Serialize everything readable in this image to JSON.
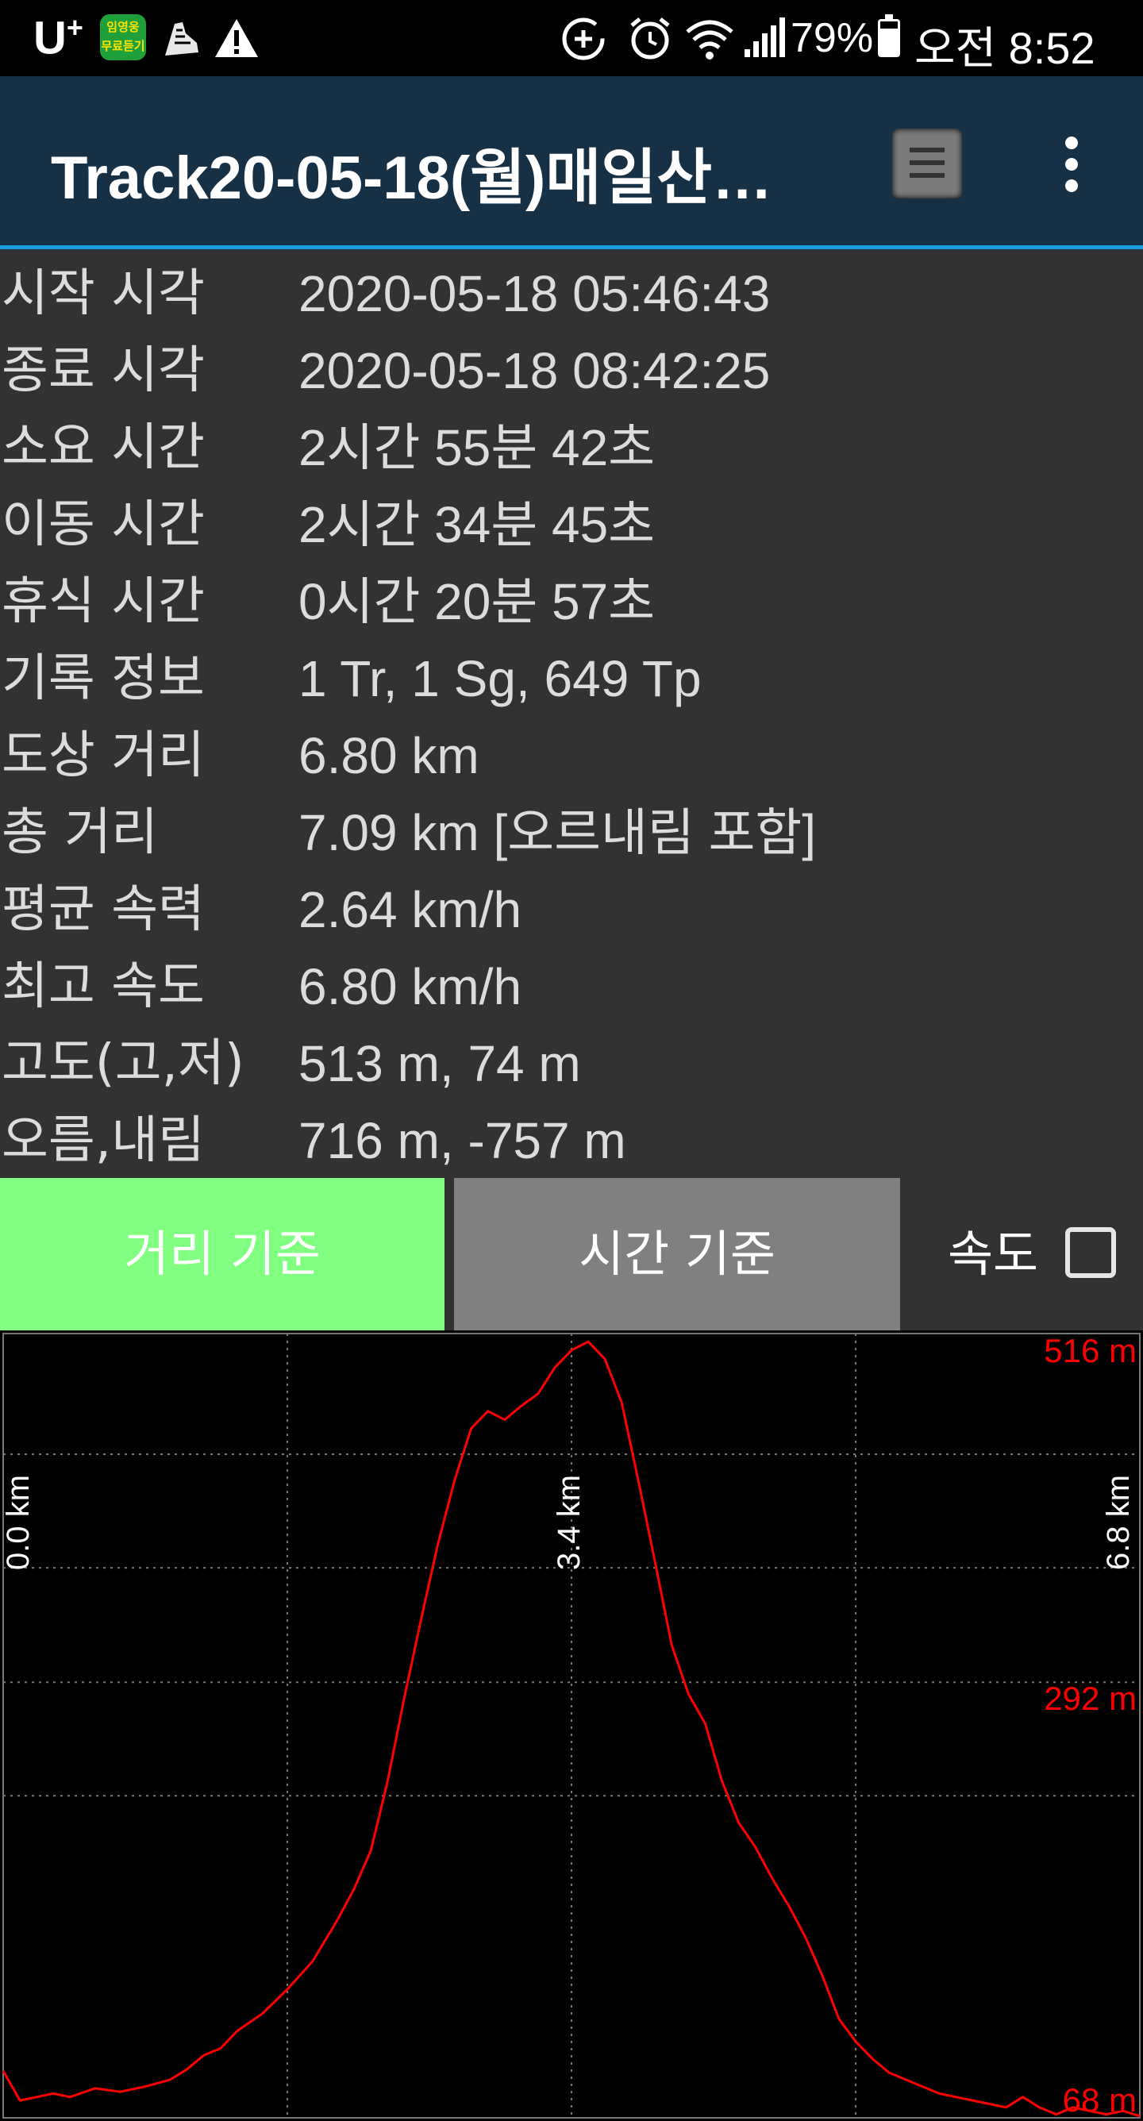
{
  "status_bar": {
    "carrier": "U",
    "carrier_sup": "+",
    "app_badge_line1": "임영웅",
    "app_badge_line2": "무료듣기",
    "icons": [
      "app-notification-icon",
      "shoe-icon",
      "warning-icon",
      "data-saver-icon",
      "alarm-icon",
      "wifi-icon",
      "signal-icon",
      "battery-icon"
    ],
    "battery_percent": "79%",
    "battery_level": 0.79,
    "time": "오전 8:52"
  },
  "appbar": {
    "title": "Track20-05-18(월)매일산…",
    "background": "#163146",
    "accent": "#1a9be0"
  },
  "stats": [
    {
      "label": "시작 시각",
      "value": "2020-05-18 05:46:43"
    },
    {
      "label": "종료 시각",
      "value": "2020-05-18 08:42:25"
    },
    {
      "label": "소요 시간",
      "value": "2시간 55분 42초"
    },
    {
      "label": "이동 시간",
      "value": "2시간 34분 45초"
    },
    {
      "label": "휴식 시간",
      "value": "0시간 20분 57초"
    },
    {
      "label": "기록 정보",
      "value": "1 Tr, 1 Sg, 649 Tp"
    },
    {
      "label": "도상 거리",
      "value": "6.80 km"
    },
    {
      "label": "총 거리",
      "value": "7.09 km [오르내림 포함]"
    },
    {
      "label": "평균 속력",
      "value": "2.64 km/h"
    },
    {
      "label": "최고 속도",
      "value": "6.80 km/h"
    },
    {
      "label": "고도(고,저)",
      "value": "513 m, 74 m"
    },
    {
      "label": "오름,내림",
      "value": "716 m, -757 m"
    }
  ],
  "buttons": {
    "distance": "거리 기준",
    "time": "시간 기준",
    "speed_label": "속도",
    "speed_checked": false,
    "distance_color": "#80ff80",
    "time_color": "#808080"
  },
  "chart_data": {
    "type": "line",
    "line_color": "#ff0000",
    "grid": true,
    "x_labels": [
      "0.0 km",
      "3.4 km",
      "6.8 km"
    ],
    "x_range": [
      0,
      6.8
    ],
    "y_labels": [
      "516 m",
      "292 m",
      "68 m"
    ],
    "y_range": [
      68,
      516
    ],
    "series": [
      {
        "x": [
          0.0,
          0.1,
          0.2,
          0.3,
          0.4,
          0.55,
          0.7,
          0.85,
          1.0,
          1.1,
          1.2,
          1.3,
          1.4,
          1.55,
          1.7,
          1.85,
          2.0,
          2.1,
          2.2,
          2.3,
          2.4,
          2.5,
          2.6,
          2.7,
          2.8,
          2.9,
          3.0,
          3.1,
          3.2,
          3.3,
          3.4,
          3.5,
          3.6,
          3.7,
          3.8,
          3.9,
          4.0,
          4.1,
          4.2,
          4.3,
          4.4,
          4.5,
          4.6,
          4.7,
          4.8,
          4.9,
          5.0,
          5.1,
          5.2,
          5.3,
          5.4,
          5.5,
          5.6,
          5.7,
          5.8,
          5.9,
          6.0,
          6.1,
          6.2,
          6.3,
          6.4,
          6.5,
          6.6,
          6.7,
          6.8
        ],
        "y": [
          95,
          78,
          80,
          82,
          80,
          85,
          83,
          86,
          90,
          96,
          104,
          108,
          118,
          128,
          142,
          158,
          182,
          200,
          222,
          262,
          310,
          355,
          398,
          435,
          465,
          475,
          470,
          478,
          485,
          500,
          510,
          515,
          505,
          480,
          435,
          388,
          340,
          312,
          295,
          262,
          238,
          224,
          206,
          190,
          172,
          150,
          125,
          112,
          102,
          94,
          90,
          86,
          82,
          80,
          78,
          76,
          74,
          80,
          74,
          70,
          74,
          72,
          70,
          72,
          69
        ]
      }
    ]
  }
}
